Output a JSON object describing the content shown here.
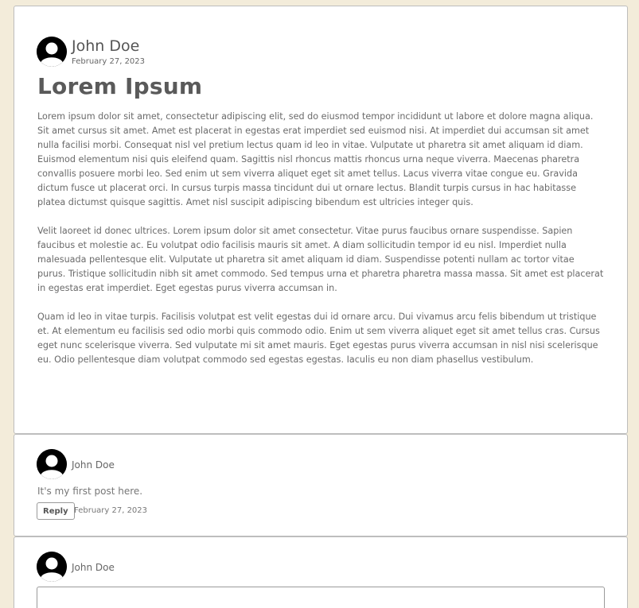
{
  "post": {
    "author": "John Doe",
    "date": "February 27, 2023",
    "title": "Lorem Ipsum",
    "paragraphs": [
      "Lorem ipsum dolor sit amet, consectetur adipiscing elit, sed do eiusmod tempor incididunt ut labore et dolore magna aliqua. Sit amet cursus sit amet. Amet est placerat in egestas erat imperdiet sed euismod nisi. At imperdiet dui accumsan sit amet nulla facilisi morbi. Consequat nisl vel pretium lectus quam id leo in vitae. Vulputate ut pharetra sit amet aliquam id diam. Euismod elementum nisi quis eleifend quam. Sagittis nisl rhoncus mattis rhoncus urna neque viverra. Maecenas pharetra convallis posuere morbi leo. Sed enim ut sem viverra aliquet eget sit amet tellus. Lacus viverra vitae congue eu. Gravida dictum fusce ut placerat orci. In cursus turpis massa tincidunt dui ut ornare lectus. Blandit turpis cursus in hac habitasse platea dictumst quisque sagittis. Amet nisl suscipit adipiscing bibendum est ultricies integer quis.",
      "Velit laoreet id donec ultrices. Lorem ipsum dolor sit amet consectetur. Vitae purus faucibus ornare suspendisse. Sapien faucibus et molestie ac. Eu volutpat odio facilisis mauris sit amet. A diam sollicitudin tempor id eu nisl. Imperdiet nulla malesuada pellentesque elit. Vulputate ut pharetra sit amet aliquam id diam. Suspendisse potenti nullam ac tortor vitae purus. Tristique sollicitudin nibh sit amet commodo. Sed tempus urna et pharetra pharetra massa massa. Sit amet est placerat in egestas erat imperdiet. Eget egestas purus viverra accumsan in.",
      "Quam id leo in vitae turpis. Facilisis volutpat est velit egestas dui id ornare arcu. Dui vivamus arcu felis bibendum ut tristique et. At elementum eu facilisis sed odio morbi quis commodo odio. Enim ut sem viverra aliquet eget sit amet tellus cras. Cursus eget nunc scelerisque viverra. Sed vulputate mi sit amet mauris. Eget egestas purus viverra accumsan in nisl nisi scelerisque eu. Odio pellentesque diam volutpat commodo sed egestas egestas. Iaculis eu non diam phasellus vestibulum."
    ]
  },
  "comment": {
    "author": "John Doe",
    "text": "It's my first post here.",
    "reply_label": "Reply",
    "date": "February 27, 2023"
  },
  "composer": {
    "author": "John Doe",
    "value": ""
  },
  "icons": {
    "avatar": "user-silhouette-icon"
  },
  "colors": {
    "background": "#f3ecda",
    "card": "#ffffff",
    "text": "#5c5c5c"
  }
}
